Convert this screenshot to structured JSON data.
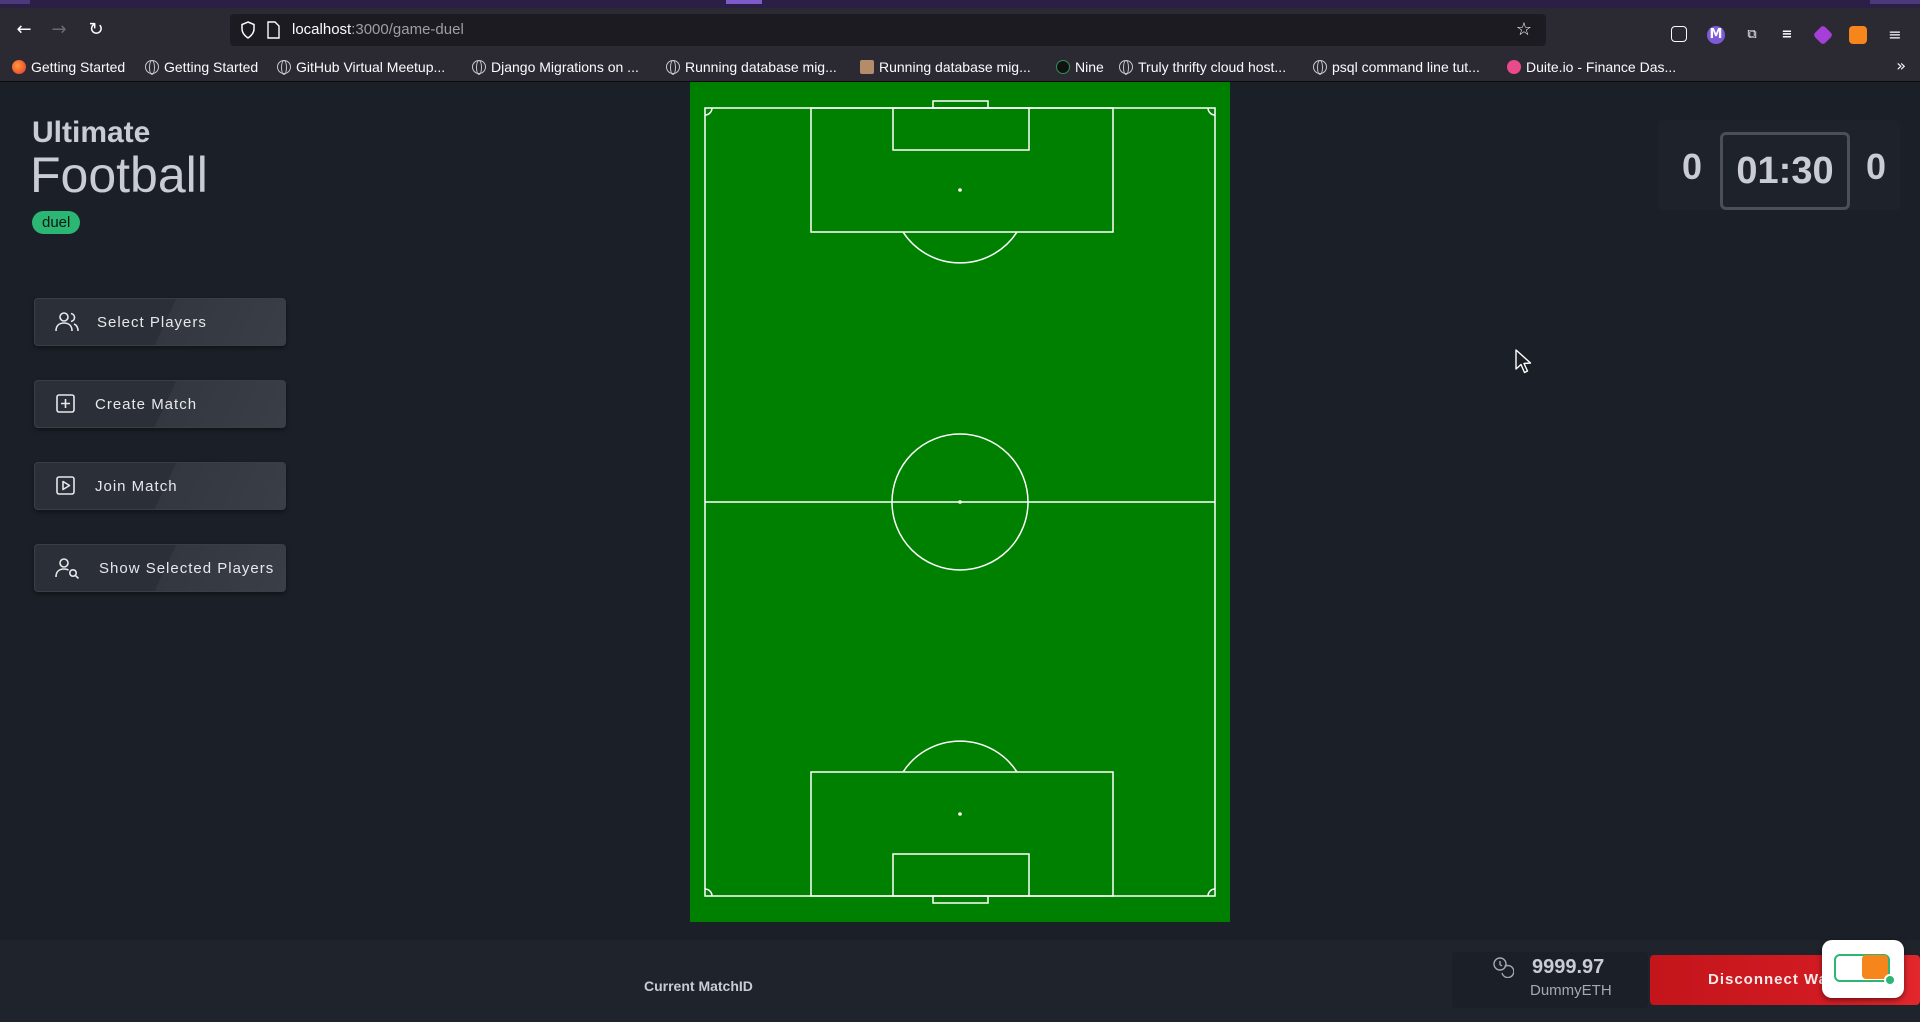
{
  "browser": {
    "url_host": "localhost",
    "url_path": ":3000/game-duel",
    "bookmarks": [
      "Getting Started",
      "Getting Started",
      "GitHub Virtual Meetup...",
      "Django Migrations on ...",
      "Running database mig...",
      "Running database mig...",
      "Nine",
      "Truly thrifty cloud host...",
      "psql command line tut...",
      "Duite.io - Finance Das..."
    ]
  },
  "brand": {
    "top": "Ultimate",
    "main": "Football",
    "mode_badge": "duel"
  },
  "menu": {
    "select_players": "Select Players",
    "create_match": "Create Match",
    "join_match": "Join Match",
    "show_selected_players": "Show Selected Players"
  },
  "scoreboard": {
    "home_score": "0",
    "time": "01:30",
    "away_score": "0"
  },
  "footer": {
    "match_id_label": "Current MatchID",
    "balance": "9999.97",
    "currency": "DummyETH",
    "disconnect_label": "Disconnect Wallet"
  },
  "colors": {
    "pitch": "#008000",
    "badge": "#2bb673",
    "disconnect": "#d11a22",
    "background": "#1b1f27"
  }
}
